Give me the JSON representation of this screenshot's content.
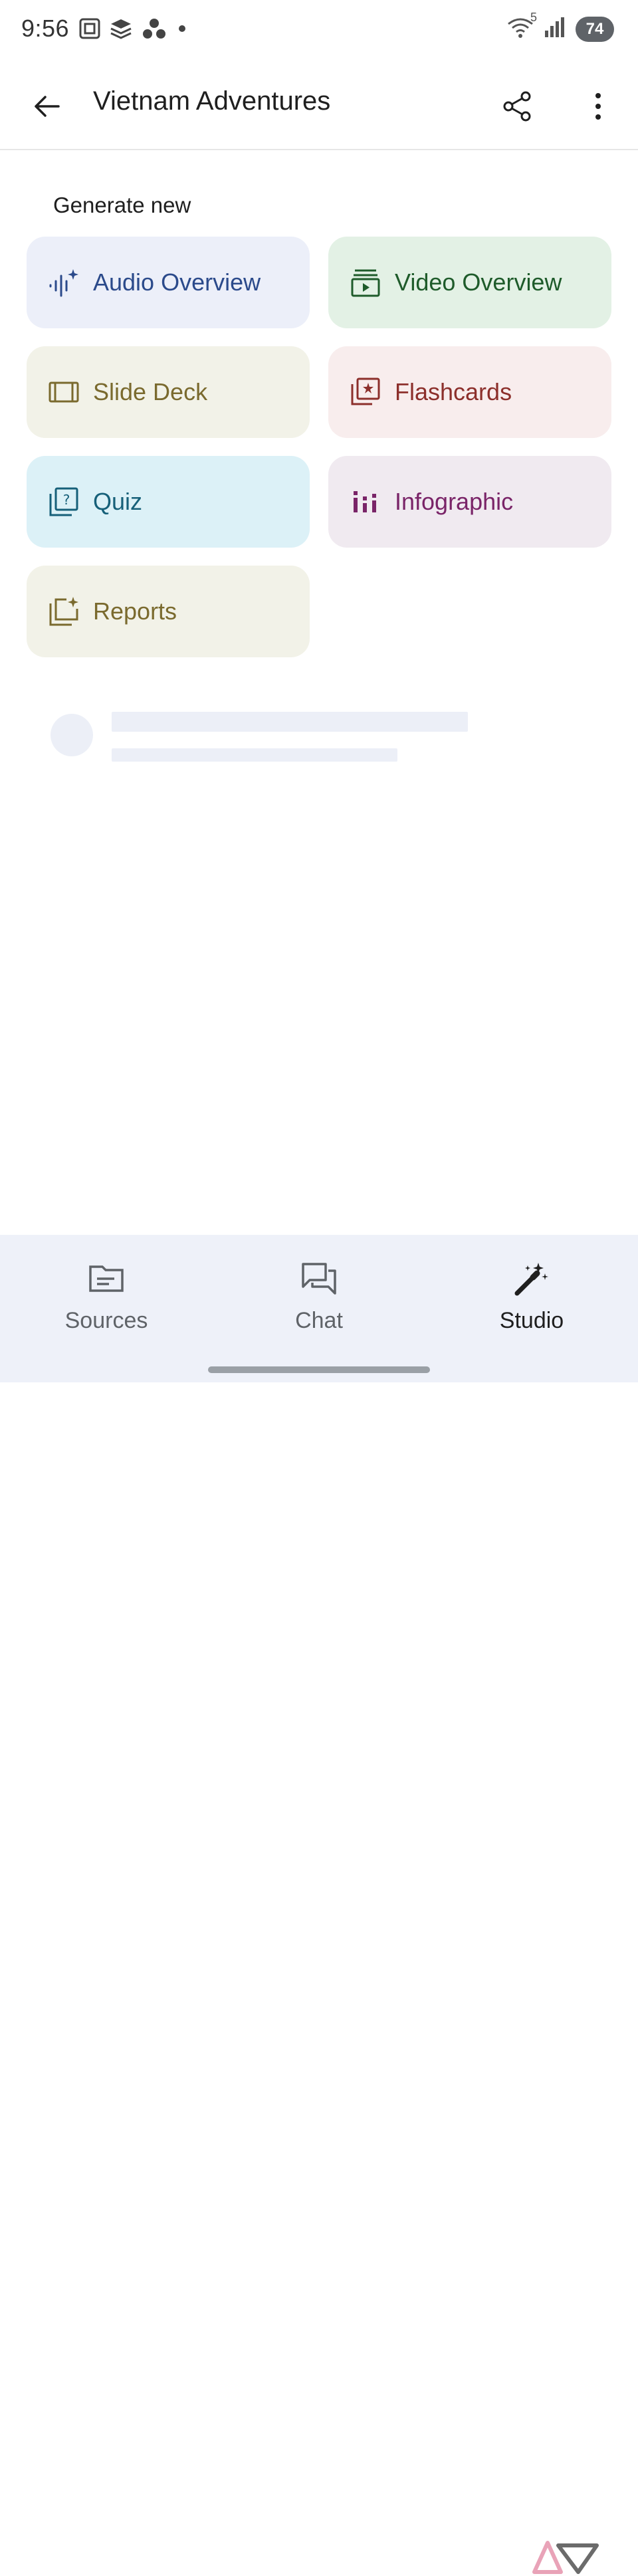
{
  "status_bar": {
    "time": "9:56",
    "battery": "74",
    "wifi_badge": "5"
  },
  "header": {
    "title": "Vietnam Adventures"
  },
  "section": {
    "title": "Generate new"
  },
  "tiles": [
    {
      "label": "Audio Overview",
      "icon": "audio-waveform-icon",
      "bg": "#eceff9",
      "fg": "#2b4a8b"
    },
    {
      "label": "Video Overview",
      "icon": "video-stack-icon",
      "bg": "#e3f1e5",
      "fg": "#1e5b2a"
    },
    {
      "label": "Slide Deck",
      "icon": "slides-icon",
      "bg": "#f2f2e8",
      "fg": "#7a6a2e"
    },
    {
      "label": "Flashcards",
      "icon": "flashcards-icon",
      "bg": "#f8eded",
      "fg": "#8c2f2b"
    },
    {
      "label": "Quiz",
      "icon": "quiz-icon",
      "bg": "#dcf1f7",
      "fg": "#166079"
    },
    {
      "label": "Infographic",
      "icon": "bar-chart-icon",
      "bg": "#f0eaf0",
      "fg": "#7a2468"
    },
    {
      "label": "Reports",
      "icon": "reports-icon",
      "bg": "#f2f2e8",
      "fg": "#7a6a2e"
    }
  ],
  "bottom_nav": {
    "items": [
      {
        "label": "Sources",
        "icon": "folder-icon"
      },
      {
        "label": "Chat",
        "icon": "chat-icon"
      },
      {
        "label": "Studio",
        "icon": "magic-wand-icon",
        "active": true
      }
    ]
  }
}
